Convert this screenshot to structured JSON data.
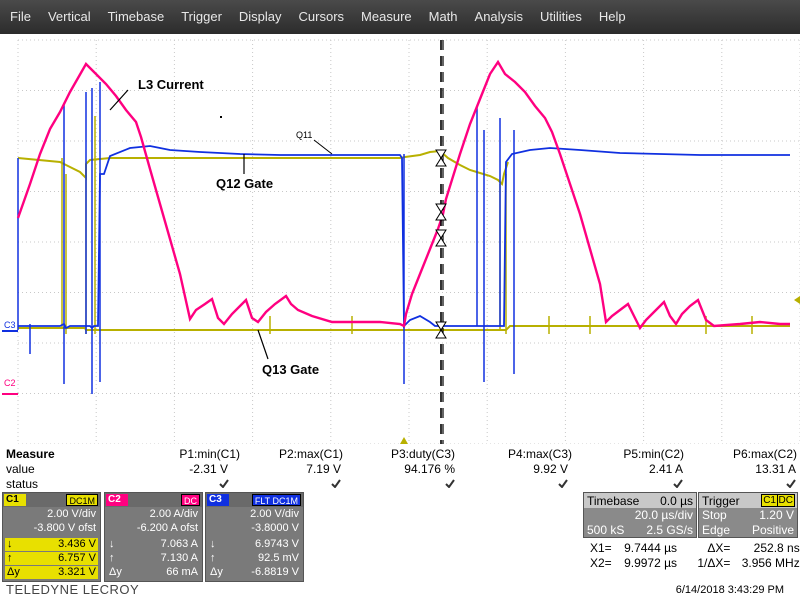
{
  "menu": [
    "File",
    "Vertical",
    "Timebase",
    "Trigger",
    "Display",
    "Cursors",
    "Measure",
    "Math",
    "Analysis",
    "Utilities",
    "Help"
  ],
  "colors": {
    "c1": "#b8b000",
    "c2": "#ff0080",
    "c3": "#1030e0",
    "grid": "#c8c8c8",
    "cursor": "#000000"
  },
  "traces": {
    "c1_name": "C1",
    "c2_name": "C2",
    "c3_name": "C3",
    "c2_label": "C2",
    "c3_label": "C3"
  },
  "annotations": {
    "l3_current": "L3 Current",
    "q12_gate": "Q12 Gate",
    "q13_gate": "Q13 Gate",
    "q11": "Q11"
  },
  "measure": {
    "header_label": "Measure",
    "value_label": "value",
    "status_label": "status",
    "params": [
      {
        "name": "P1:min(C1)",
        "value": "-2.31 V"
      },
      {
        "name": "P2:max(C1)",
        "value": "7.19 V"
      },
      {
        "name": "P3:duty(C3)",
        "value": "94.176 %"
      },
      {
        "name": "P4:max(C3)",
        "value": "9.92 V"
      },
      {
        "name": "P5:min(C2)",
        "value": "2.41 A"
      },
      {
        "name": "P6:max(C2)",
        "value": "13.31 A"
      }
    ]
  },
  "channels": [
    {
      "tag": "C1",
      "coupling": "DC1M",
      "volt_div": "2.00 V/div",
      "offset": "-3.800 V ofst",
      "l1_label": "↓",
      "l1": "3.436 V",
      "l2_label": "↑",
      "l2": "6.757 V",
      "l3_label": "Δy",
      "l3": "3.321 V",
      "tag_bg": "#e8e000",
      "tag_fg": "#000",
      "cpl_bg": "#e8e000",
      "cpl_fg": "#000"
    },
    {
      "tag": "C2",
      "coupling": "DC",
      "volt_div": "2.00 A/div",
      "offset": "-6.200 A ofst",
      "l1_label": "↓",
      "l1": "7.063 A",
      "l2_label": "↑",
      "l2": "7.130 A",
      "l3_label": "Δy",
      "l3": "66 mA",
      "tag_bg": "#ff0080",
      "tag_fg": "#fff",
      "cpl_bg": "#ff0080",
      "cpl_fg": "#fff"
    },
    {
      "tag": "C3",
      "coupling": "FLT DC1M",
      "volt_div": "2.00 V/div",
      "offset": "-3.8000 V",
      "l1_label": "↓",
      "l1": "6.9743 V",
      "l2_label": "↑",
      "l2": "92.5 mV",
      "l3_label": "Δy",
      "l3": "-6.8819 V",
      "tag_bg": "#1030e0",
      "tag_fg": "#fff",
      "cpl_bg": "#1030e0",
      "cpl_fg": "#fff"
    }
  ],
  "timebase": {
    "label": "Timebase",
    "delay": "0.0 µs",
    "time_div": "20.0 µs/div",
    "samples": "500 kS",
    "rate": "2.5 GS/s"
  },
  "trigger": {
    "label": "Trigger",
    "source": "C1",
    "coupling": "DC",
    "mode": "Stop",
    "level": "1.20 V",
    "type": "Edge",
    "slope": "Positive"
  },
  "cursors": {
    "x1_label": "X1=",
    "x1": "9.7444 µs",
    "dx_label": "ΔX=",
    "dx": "252.8 ns",
    "x2_label": "X2=",
    "x2": "9.9972 µs",
    "inv_dx_label": "1/ΔX=",
    "inv_dx": "3.956 MHz"
  },
  "footer": {
    "logo": "TELEDYNE LECROY",
    "datetime": "6/14/2018 3:43:29 PM"
  }
}
